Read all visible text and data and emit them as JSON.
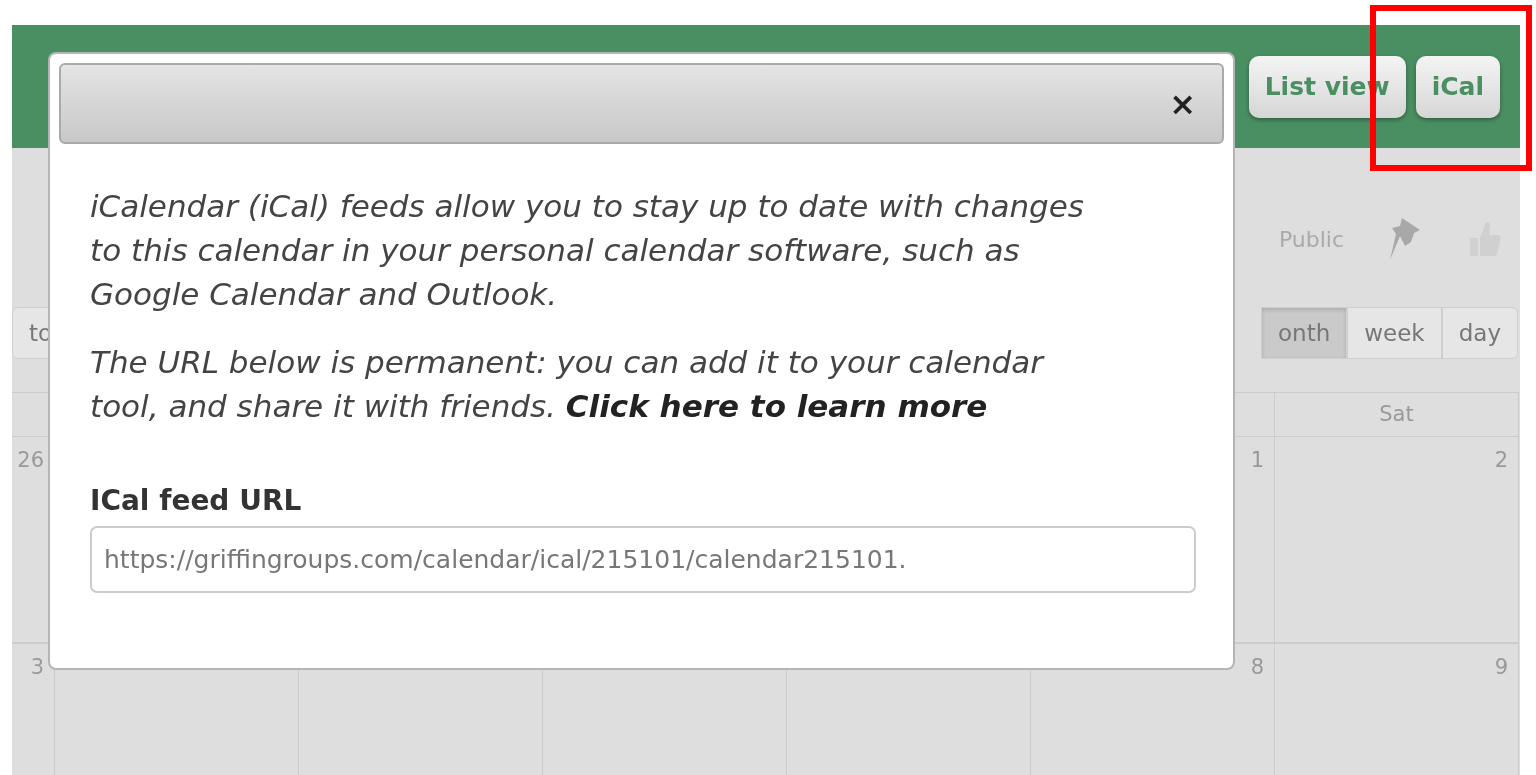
{
  "header": {
    "buttons": [
      {
        "label": "List view"
      },
      {
        "label": "iCal"
      }
    ]
  },
  "toolbar": {
    "visibility": "Public",
    "left_button": "to",
    "view_buttons": [
      {
        "label": "onth",
        "selected": true
      },
      {
        "label": "week",
        "selected": false
      },
      {
        "label": "day",
        "selected": false
      }
    ]
  },
  "calendar": {
    "last_heading": "Sat",
    "weeks": [
      {
        "first": "26",
        "last": [
          "1",
          "2"
        ]
      },
      {
        "first": "3",
        "last": [
          "8",
          "9"
        ]
      }
    ]
  },
  "modal": {
    "close": "×",
    "intro": "iCalendar (iCal) feeds allow you to stay up to date with changes to this calendar in your personal calendar software, such as Google Calendar and Outlook.",
    "note": "The URL below is permanent: you can add it to your calendar tool, and share it with friends.",
    "link": "Click here to learn more",
    "field_label": "ICal feed URL",
    "field_value": "https://griffingroups.com/calendar/ical/215101/calendar215101."
  }
}
